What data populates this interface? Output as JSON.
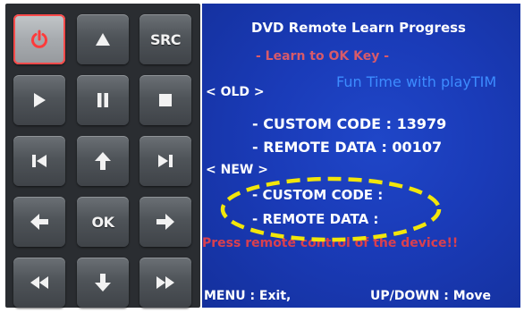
{
  "keypad": {
    "keys": [
      {
        "name": "power-key",
        "icon": "power-icon",
        "label": ""
      },
      {
        "name": "up-key",
        "icon": "triangle-up-icon",
        "label": ""
      },
      {
        "name": "src-key",
        "icon": "",
        "label": "SRC"
      },
      {
        "name": "play-key",
        "icon": "play-icon",
        "label": ""
      },
      {
        "name": "pause-key",
        "icon": "pause-icon",
        "label": ""
      },
      {
        "name": "stop-key",
        "icon": "stop-icon",
        "label": ""
      },
      {
        "name": "prev-key",
        "icon": "skip-back-icon",
        "label": ""
      },
      {
        "name": "up-arrow-key",
        "icon": "arrow-up-icon",
        "label": ""
      },
      {
        "name": "next-key",
        "icon": "skip-forward-icon",
        "label": ""
      },
      {
        "name": "left-arrow-key",
        "icon": "arrow-left-icon",
        "label": ""
      },
      {
        "name": "ok-key",
        "icon": "",
        "label": "OK"
      },
      {
        "name": "right-arrow-key",
        "icon": "arrow-right-icon",
        "label": ""
      },
      {
        "name": "rewind-key",
        "icon": "rewind-icon",
        "label": ""
      },
      {
        "name": "down-arrow-key",
        "icon": "arrow-down-icon",
        "label": ""
      },
      {
        "name": "fast-forward-key",
        "icon": "fast-forward-icon",
        "label": ""
      }
    ],
    "active_key": "power-key",
    "colors": {
      "active_outline": "#ff4a4a",
      "panel": "#2a2d31"
    }
  },
  "screen": {
    "title": "DVD Remote Learn Progress",
    "subtitle": "- Learn to OK Key -",
    "banner": "Fun Time with playTIM",
    "old_label": "< OLD >",
    "old_custom_code": "- CUSTOM CODE :  13979",
    "old_remote_data": "- REMOTE DATA :  00107",
    "new_label": "< NEW >",
    "new_custom_code": "- CUSTOM CODE :",
    "new_remote_data": "- REMOTE DATA :",
    "press_message": "Press remote control of the device!!",
    "menu_exit": "MENU : Exit,",
    "up_down": "UP/DOWN : Move",
    "colors": {
      "background": "#1a3bb8",
      "subtitle": "#d75a6a",
      "banner": "#3d8cff",
      "press_message": "#d9404f",
      "highlight": "#f2e60a"
    }
  }
}
